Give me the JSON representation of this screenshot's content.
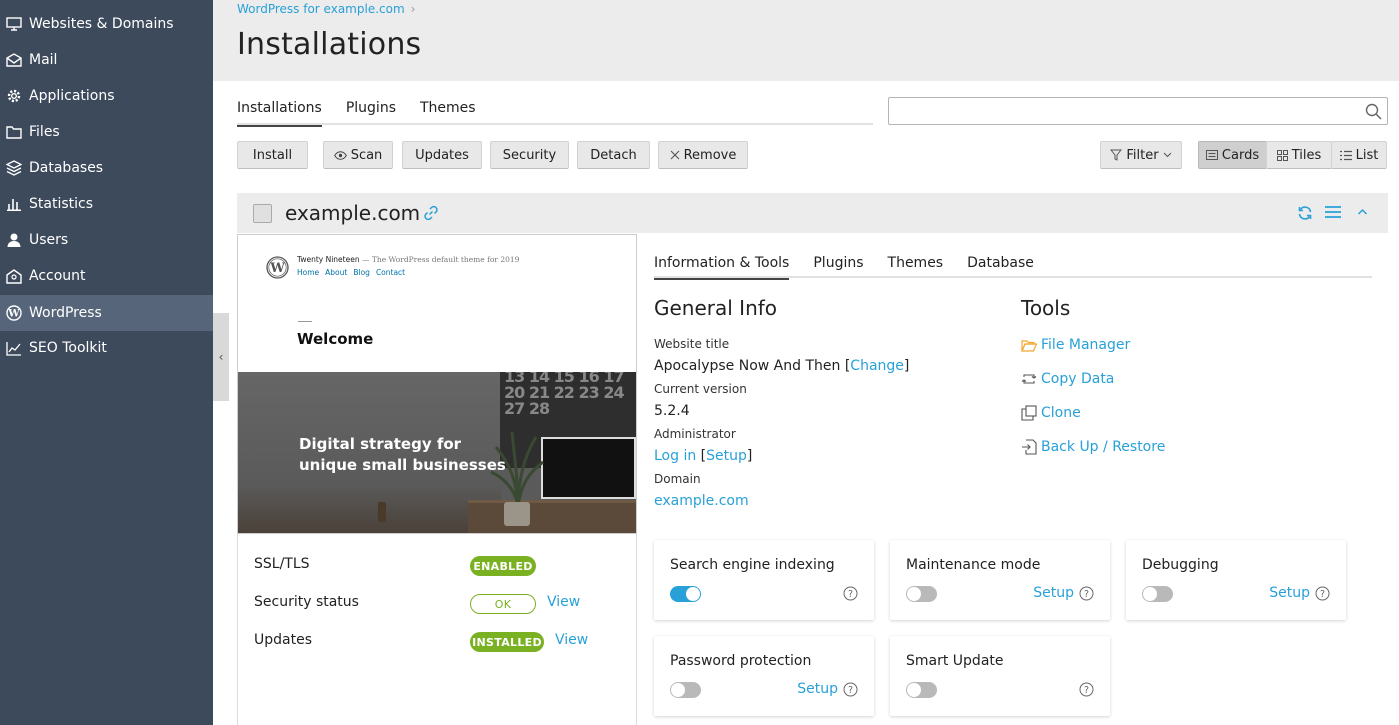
{
  "sidebar": {
    "items": [
      {
        "label": "Websites & Domains",
        "icon": "monitor-icon"
      },
      {
        "label": "Mail",
        "icon": "mail-icon"
      },
      {
        "label": "Applications",
        "icon": "gear-icon"
      },
      {
        "label": "Files",
        "icon": "folder-icon"
      },
      {
        "label": "Databases",
        "icon": "database-icon"
      },
      {
        "label": "Statistics",
        "icon": "bar-chart-icon"
      },
      {
        "label": "Users",
        "icon": "user-icon"
      },
      {
        "label": "Account",
        "icon": "account-icon"
      },
      {
        "label": "WordPress",
        "icon": "wordpress-icon",
        "active": true
      },
      {
        "label": "SEO Toolkit",
        "icon": "seo-chart-icon"
      }
    ],
    "collapse_glyph": "‹"
  },
  "header": {
    "breadcrumb": "WordPress for example.com",
    "title": "Installations"
  },
  "tabs": [
    "Installations",
    "Plugins",
    "Themes"
  ],
  "search": {
    "placeholder": "",
    "value": ""
  },
  "toolbar": {
    "install": "Install",
    "scan": "Scan",
    "updates": "Updates",
    "security": "Security",
    "detach": "Detach",
    "remove": "Remove",
    "filter": "Filter",
    "cards": "Cards",
    "tiles": "Tiles",
    "list": "List"
  },
  "card": {
    "domain": "example.com",
    "preview": {
      "theme_name": "Twenty Nineteen",
      "theme_tagline": "— The WordPress default theme for 2019",
      "nav": [
        "Home",
        "About",
        "Blog",
        "Contact"
      ],
      "welcome": "Welcome",
      "hero_line1": "Digital strategy for",
      "hero_line2": "unique small businesses",
      "calendar_row1": "13 14 15 16 17",
      "calendar_row2": "20 21 22 23 24",
      "calendar_row3": "27 28"
    },
    "status": {
      "ssl_label": "SSL/TLS",
      "ssl_badge": "ENABLED",
      "security_label": "Security status",
      "security_badge": "OK",
      "security_link": "View",
      "updates_label": "Updates",
      "updates_badge": "INSTALLED",
      "updates_link": "View"
    },
    "info_tabs": [
      "Information & Tools",
      "Plugins",
      "Themes",
      "Database"
    ],
    "general": {
      "title": "General Info",
      "website_title_label": "Website title",
      "website_title": "Apocalypse Now And Then",
      "bracket_open": "[",
      "change_link": "Change",
      "bracket_close": "]",
      "version_label": "Current version",
      "version": "5.2.4",
      "admin_label": "Administrator",
      "login_link": "Log in",
      "setup_link": "Setup",
      "domain_label": "Domain",
      "domain_link": "example.com"
    },
    "tools": {
      "title": "Tools",
      "file_manager": "File Manager",
      "copy_data": "Copy Data",
      "clone": "Clone",
      "backup": "Back Up / Restore"
    },
    "tiles": [
      {
        "title": "Search engine indexing",
        "on": true,
        "setup": ""
      },
      {
        "title": "Maintenance mode",
        "on": false,
        "setup": "Setup"
      },
      {
        "title": "Debugging",
        "on": false,
        "setup": "Setup"
      },
      {
        "title": "Password protection",
        "on": false,
        "setup": "Setup"
      },
      {
        "title": "Smart Update",
        "on": false,
        "setup": ""
      }
    ]
  },
  "colors": {
    "sidebar_bg": "#3d4a5c",
    "sidebar_active": "#56657a",
    "link": "#28a0d8",
    "badge_green": "#7ab123",
    "folder": "#f0a830"
  }
}
